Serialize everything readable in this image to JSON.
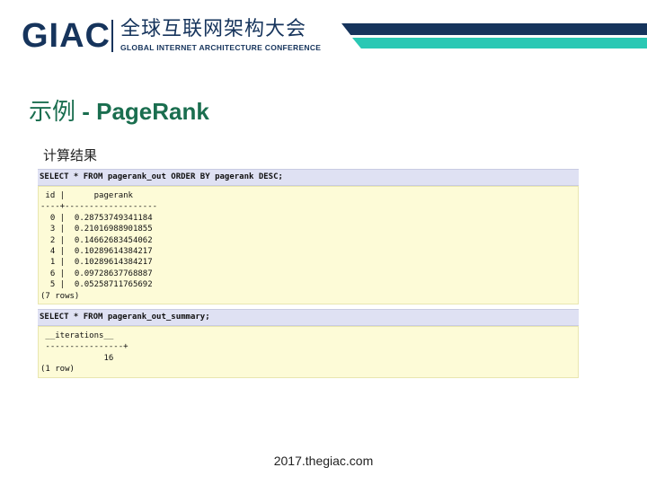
{
  "header": {
    "logo_text": "GIAC",
    "logo_cn": "全球互联网架构大会",
    "logo_en": "GLOBAL INTERNET ARCHITECTURE CONFERENCE"
  },
  "colors": {
    "navy": "#16345c",
    "teal": "#2ac8b4",
    "title_green": "#1a6e4f"
  },
  "slide": {
    "title_cn": "示例",
    "title_en": " - PageRank",
    "subtitle": "计算结果"
  },
  "sql1": {
    "query": "SELECT * FROM pagerank_out ORDER BY pagerank DESC;",
    "header": " id |      pagerank",
    "separator": "----+-------------------",
    "rows": [
      "  0 |  0.28753749341184",
      "  3 |  0.21016988901855",
      "  2 |  0.14662683454062",
      "  4 |  0.10289614384217",
      "  1 |  0.10289614384217",
      "  6 |  0.09728637768887",
      "  5 |  0.05258711765692"
    ],
    "footer": "(7 rows)"
  },
  "sql2": {
    "query": "SELECT * FROM pagerank_out_summary;",
    "header": " __iterations__",
    "separator": " ----------------+",
    "rows": [
      "             16"
    ],
    "footer": "(1 row)"
  },
  "footer": {
    "url": "2017.thegiac.com"
  }
}
